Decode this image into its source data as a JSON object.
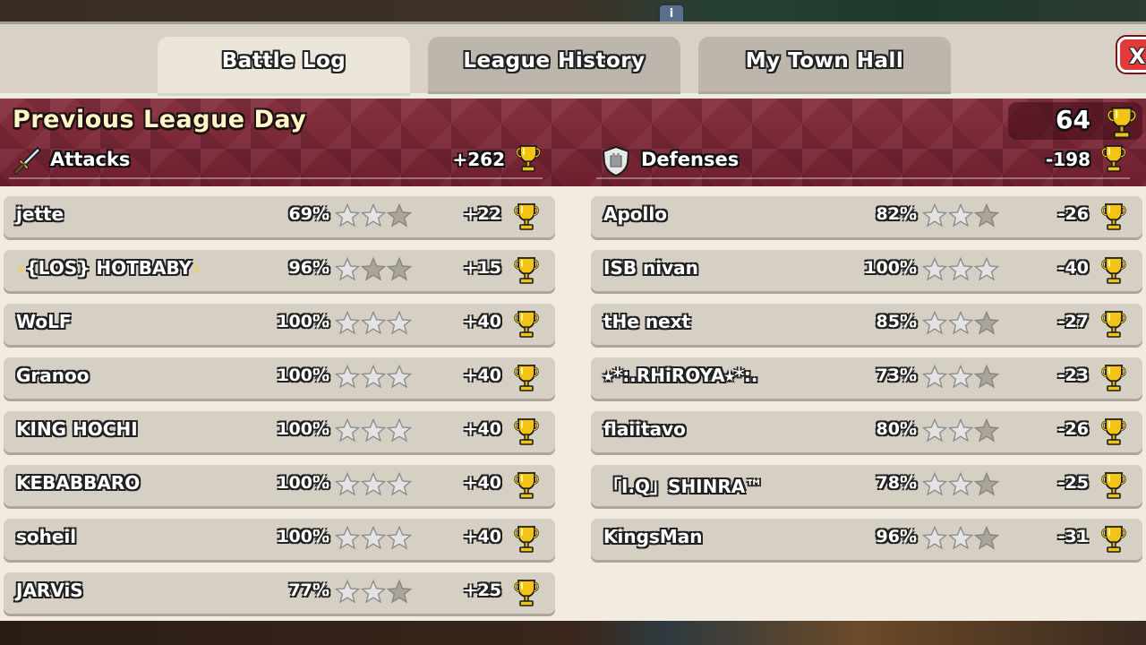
{
  "tabs": [
    "Battle Log",
    "League History",
    "My Town Hall"
  ],
  "close_label": "X",
  "info_label": "i",
  "banner": {
    "title": "Previous League Day",
    "total_trophies": "64"
  },
  "attacks": {
    "label": "Attacks",
    "total": "+262",
    "rows": [
      {
        "name": "jette",
        "percent": "69%",
        "stars": 2,
        "trophies": "+22"
      },
      {
        "name": "{LOS} HOTBABY",
        "bolts": true,
        "percent": "96%",
        "stars": 1,
        "trophies": "+15"
      },
      {
        "name": "WoLF",
        "percent": "100%",
        "stars": 3,
        "trophies": "+40"
      },
      {
        "name": "Granoo",
        "percent": "100%",
        "stars": 3,
        "trophies": "+40"
      },
      {
        "name": "KING HOCHI",
        "percent": "100%",
        "stars": 3,
        "trophies": "+40"
      },
      {
        "name": "KEBABBARO",
        "percent": "100%",
        "stars": 3,
        "trophies": "+40"
      },
      {
        "name": "soheil",
        "percent": "100%",
        "stars": 3,
        "trophies": "+40"
      },
      {
        "name": "JARViS",
        "percent": "77%",
        "stars": 2,
        "trophies": "+25"
      }
    ]
  },
  "defenses": {
    "label": "Defenses",
    "total": "-198",
    "rows": [
      {
        "name": "Apollo",
        "percent": "82%",
        "stars": 2,
        "trophies": "-26"
      },
      {
        "name": "ISB nivan",
        "percent": "100%",
        "stars": 3,
        "trophies": "-40"
      },
      {
        "name": "tHe next",
        "percent": "85%",
        "stars": 2,
        "trophies": "-27"
      },
      {
        "name": "⭒*:.RHiROYA⭒*:.",
        "percent": "73%",
        "stars": 2,
        "trophies": "-23"
      },
      {
        "name": "flaiitavo",
        "percent": "80%",
        "stars": 2,
        "trophies": "-26"
      },
      {
        "name": "「I.Q」SHINRA™",
        "percent": "78%",
        "stars": 2,
        "trophies": "-25"
      },
      {
        "name": "KingsMan",
        "percent": "96%",
        "stars": 2,
        "trophies": "-31"
      }
    ]
  },
  "colors": {
    "banner": "#7a2433",
    "row": "#d6cfc3",
    "panel": "#f1ebe2",
    "star_on": "#e3e3e3",
    "star_off": "#a9a49c",
    "trophy": "#f2c418",
    "close": "#e23a3a"
  }
}
